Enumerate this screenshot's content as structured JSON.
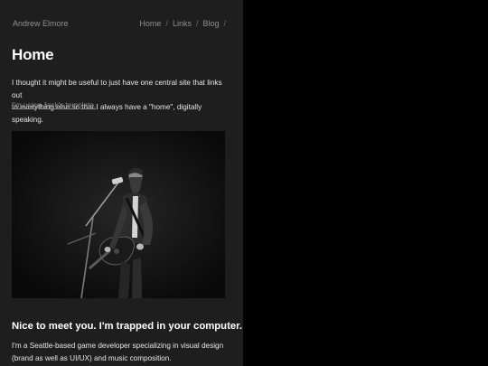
{
  "header": {
    "site_name": "Andrew Elmore",
    "nav": [
      "Home",
      "Links",
      "Blog"
    ],
    "separator": "/"
  },
  "main": {
    "title": "Home",
    "intro_lines": [
      "I thought it might be useful to just have one central site that links out",
      "to everything else so that I always have a \"home\", digitally speaking."
    ],
    "template_link": "I'm using Jack's template.",
    "section_title": "Nice to meet you. I'm trapped in your computer.",
    "section_lines": [
      "I'm a Seattle-based game developer specializing in visual design",
      "(brand as well as UI/UX) and music composition."
    ]
  },
  "colors": {
    "page_background": "#000000",
    "content_background": "#1e1e1e",
    "text": "#e6e6e6",
    "heading": "#ffffff",
    "muted": "#8f8f8f"
  }
}
